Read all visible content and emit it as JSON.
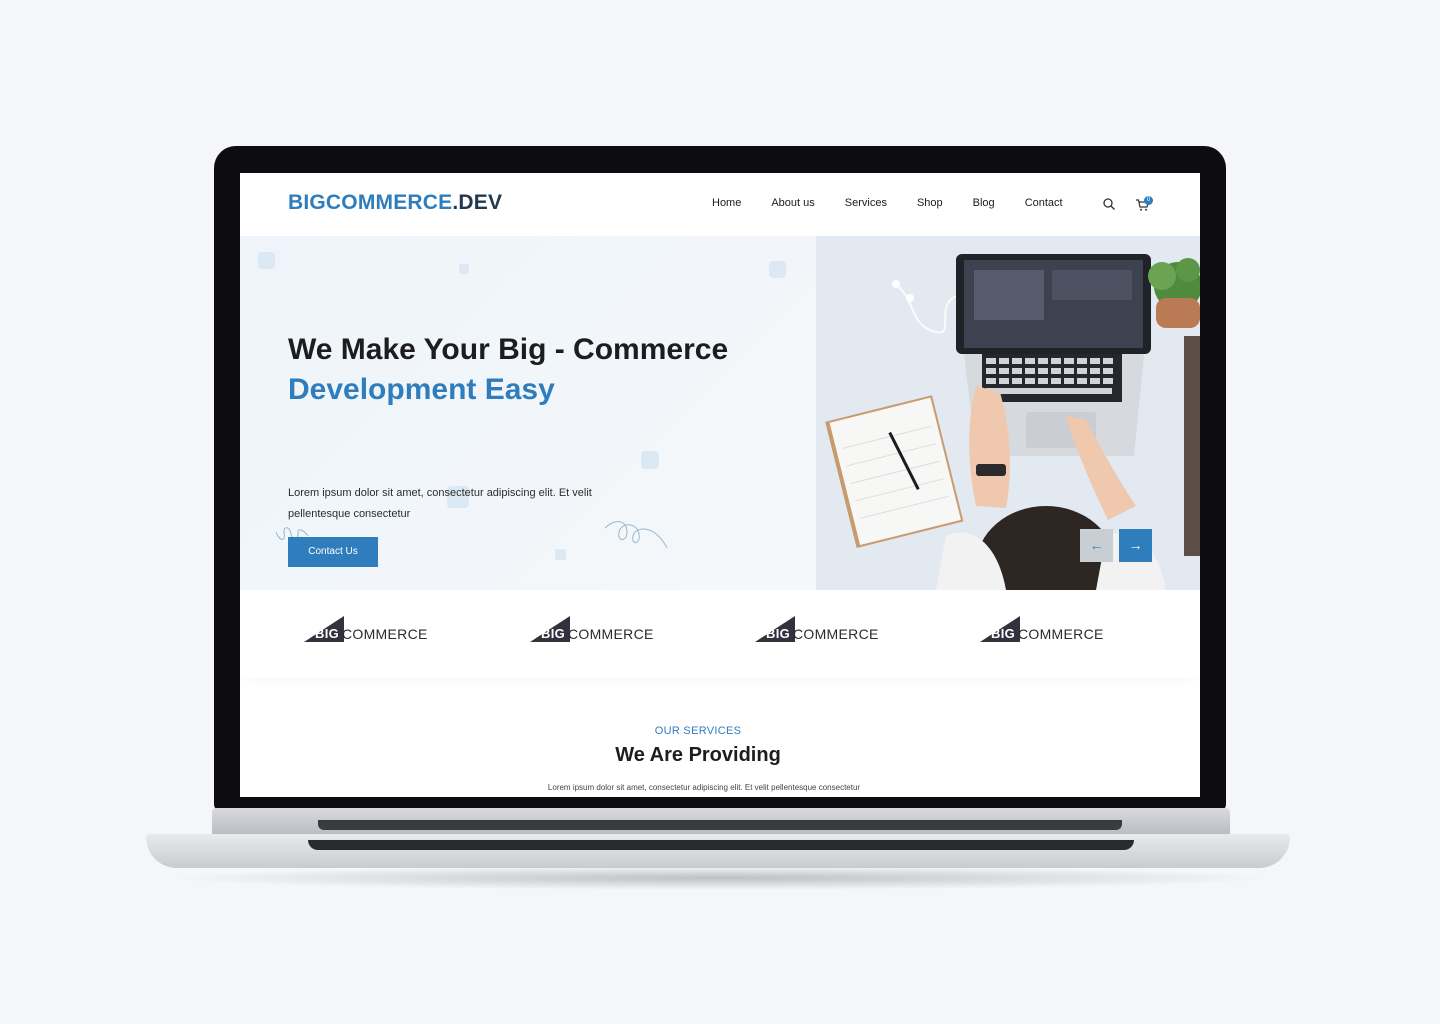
{
  "header": {
    "logo_brand": "BIGCOMMERCE",
    "logo_suffix": ".DEV",
    "nav": [
      "Home",
      "About us",
      "Services",
      "Shop",
      "Blog",
      "Contact"
    ],
    "cart_count": "0"
  },
  "hero": {
    "title_line1": "We Make Your Big - Commerce",
    "title_line2": "Development Easy",
    "text": "Lorem ipsum dolor sit amet, consectetur adipiscing elit. Et velit pellentesque consectetur",
    "cta_label": "Contact Us",
    "prev_arrow": "←",
    "next_arrow": "→"
  },
  "partners": [
    {
      "big": "BIG",
      "commerce": "COMMERCE"
    },
    {
      "big": "BIG",
      "commerce": "COMMERCE"
    },
    {
      "big": "BIG",
      "commerce": "COMMERCE"
    },
    {
      "big": "BIG",
      "commerce": "COMMERCE"
    }
  ],
  "services": {
    "eyebrow": "OUR SERVICES",
    "title": "We Are Providing",
    "text": "Lorem ipsum dolor sit amet, consectetur adipiscing elit. Et velit pellentesque consectetur"
  },
  "colors": {
    "accent": "#2f7dbd",
    "dark": "#1d1d1f",
    "background": "#f4f6f9"
  },
  "icons": [
    "search-icon",
    "cart-icon",
    "arrow-left-icon",
    "arrow-right-icon",
    "bigcommerce-logo-icon"
  ]
}
